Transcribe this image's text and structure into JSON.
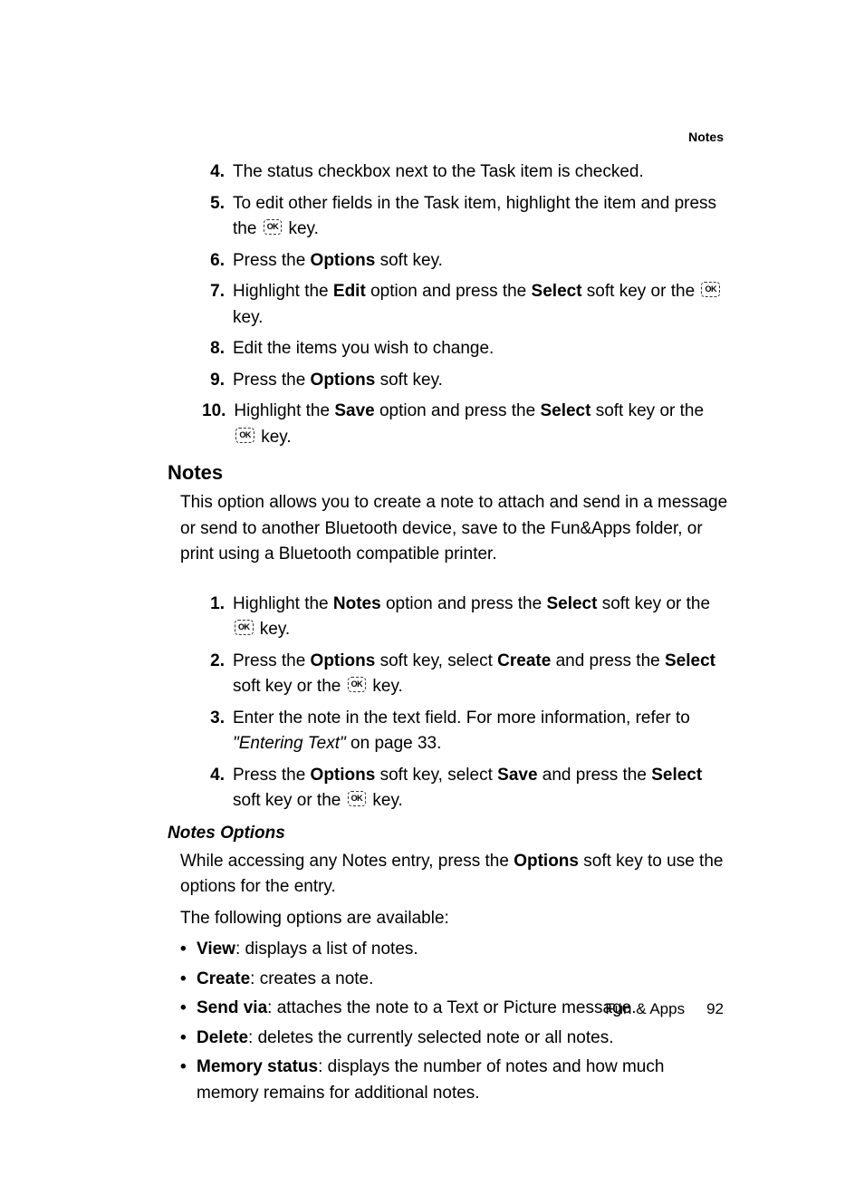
{
  "header": {
    "section_label": "Notes"
  },
  "list1": [
    {
      "num": "4.",
      "t1": "The status checkbox next to the Task item is checked."
    },
    {
      "num": "5.",
      "t1": "To edit other fields in the Task item, highlight the item and press the ",
      "ok": true,
      "t2": " key."
    },
    {
      "num": "6.",
      "t1": "Press the ",
      "b1": "Options",
      "t2": " soft key."
    },
    {
      "num": "7.",
      "t1": "Highlight the ",
      "b1": "Edit",
      "t2": " option and press the ",
      "b2": "Select",
      "t3": " soft key or the ",
      "ok": true,
      "t4": " key."
    },
    {
      "num": "8.",
      "t1": "Edit the items you wish to change."
    },
    {
      "num": "9.",
      "t1": "Press the ",
      "b1": "Options",
      "t2": " soft key."
    },
    {
      "num": "10.",
      "t1": "Highlight the ",
      "b1": "Save",
      "t2": " option and press the ",
      "b2": "Select",
      "t3": " soft key or the ",
      "ok": true,
      "t4": " key."
    }
  ],
  "section_notes": {
    "heading": "Notes",
    "intro": "This option allows you to create a note to attach and send in a message or send to another Bluetooth device, save to the Fun&Apps folder, or print using a Bluetooth compatible printer."
  },
  "list2": [
    {
      "num": "1.",
      "t1": "Highlight the ",
      "b1": "Notes",
      "t2": " option and press the ",
      "b2": "Select",
      "t3": " soft key or the ",
      "ok": true,
      "t4": " key."
    },
    {
      "num": "2.",
      "t1": "Press the ",
      "b1": "Options",
      "t2": " soft key, select ",
      "b2": "Create",
      "t3": " and press the ",
      "b3": "Select",
      "t4": " soft key or the ",
      "ok": true,
      "t5": " key."
    },
    {
      "num": "3.",
      "t1": "Enter the note in the text field. For more information, refer to ",
      "i1": "\"Entering Text\"",
      "t2": "  on page 33."
    },
    {
      "num": "4.",
      "t1": "Press the ",
      "b1": "Options",
      "t2": " soft key, select ",
      "b2": "Save",
      "t3": " and press the ",
      "b3": "Select",
      "t4": " soft key or the ",
      "ok": true,
      "t5": " key."
    }
  ],
  "notes_options": {
    "heading": "Notes Options",
    "p1a": "While accessing any Notes entry, press the ",
    "p1b": "Options",
    "p1c": " soft key to use the options for the entry.",
    "p2": "The following options are available:"
  },
  "bullets": [
    {
      "b": "View",
      "t": ": displays a list of notes."
    },
    {
      "b": "Create",
      "t": ": creates a note."
    },
    {
      "b": "Send via",
      "t": ": attaches the note to a Text or Picture message."
    },
    {
      "b": "Delete",
      "t": ": deletes the currently selected note or all notes."
    },
    {
      "b": "Memory status",
      "t": ": displays the number of notes and how much memory remains for additional notes."
    }
  ],
  "footer": {
    "section": "Fun & Apps",
    "page": "92"
  },
  "ok_label": "OK"
}
